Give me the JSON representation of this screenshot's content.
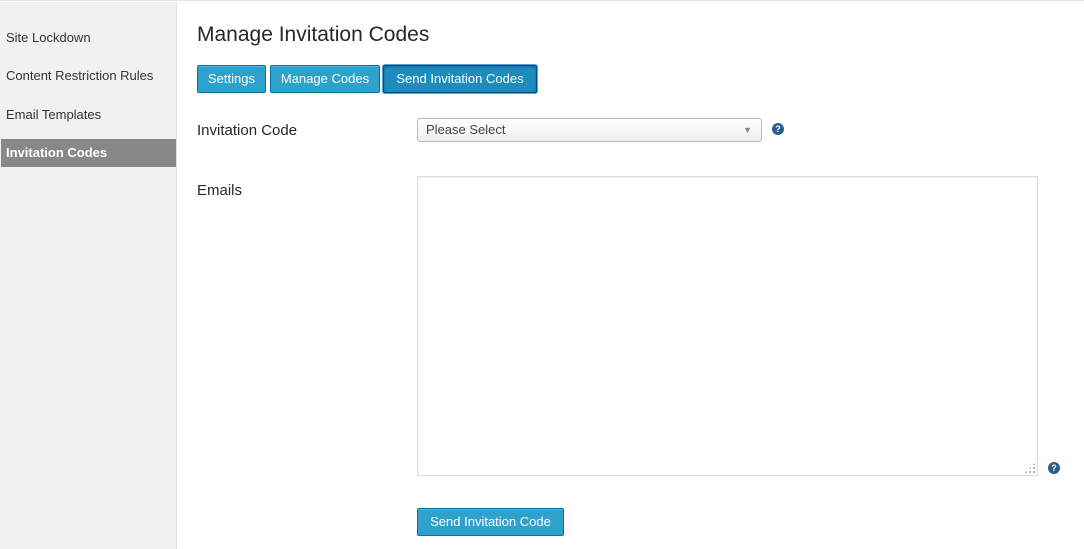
{
  "sidebar": {
    "items": [
      {
        "label": "Site Lockdown"
      },
      {
        "label": "Content Restriction Rules"
      },
      {
        "label": "Email Templates"
      },
      {
        "label": "Invitation Codes"
      }
    ]
  },
  "main": {
    "title": "Manage Invitation Codes",
    "tabs": [
      {
        "label": "Settings"
      },
      {
        "label": "Manage Codes"
      },
      {
        "label": "Send Invitation Codes"
      }
    ],
    "invitation_code": {
      "label": "Invitation Code",
      "selected": "Please Select"
    },
    "emails": {
      "label": "Emails",
      "value": ""
    },
    "submit_label": "Send Invitation Code",
    "help_glyph": "?",
    "caret_glyph": "▼"
  },
  "colors": {
    "button_bg": "#2ea2cc",
    "button_border": "#0074a2",
    "sidebar_bg": "#f1f1f1",
    "sidebar_active_bg": "#888888",
    "help_icon": "#2a5e8e"
  }
}
